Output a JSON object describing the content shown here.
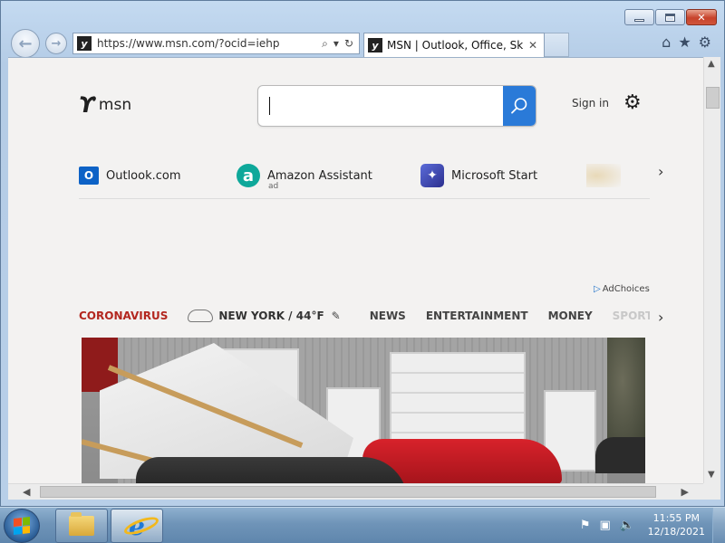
{
  "window": {
    "caption": {
      "minimize_icon": "minimize-icon",
      "maximize_icon": "maximize-icon",
      "close_glyph": "✕"
    }
  },
  "toolbar": {
    "back_glyph": "←",
    "forward_glyph": "→",
    "address": "https://www.msn.com/?ocid=iehp",
    "search_glyph": "⌕",
    "dropdown_glyph": "▾",
    "refresh_glyph": "↻",
    "home_glyph": "⌂",
    "favorites_glyph": "★",
    "tools_glyph": "⚙"
  },
  "tab": {
    "title": "MSN | Outlook, Office, Sky...",
    "close_glyph": "✕"
  },
  "msn": {
    "logo_text": "msn",
    "search_placeholder": "",
    "sign_in": "Sign in",
    "settings_glyph": "⚙",
    "quick_links": [
      {
        "label": "Outlook.com",
        "icon": "outlook-icon",
        "glyph": "O"
      },
      {
        "label": "Amazon Assistant",
        "icon": "amazon-icon",
        "glyph": "a",
        "sub": "ad"
      },
      {
        "label": "Microsoft Start",
        "icon": "microsoft-start-icon",
        "glyph": "✦"
      }
    ],
    "next_glyph": "›",
    "adchoices": "AdChoices",
    "adchoices_glyph": "▷",
    "nav": {
      "coronavirus": "CORONAVIRUS",
      "weather": "NEW YORK / 44°F",
      "edit_glyph": "✎",
      "items": [
        "NEWS",
        "ENTERTAINMENT",
        "MONEY",
        "SPORTS"
      ]
    }
  },
  "scroll": {
    "up_glyph": "▲",
    "down_glyph": "▼",
    "left_glyph": "◀",
    "right_glyph": "▶"
  },
  "taskbar": {
    "clock_time": "11:55 PM",
    "clock_date": "12/18/2021",
    "ie_glyph": "e",
    "tray": {
      "action_center_glyph": "⚑",
      "network_glyph": "▣",
      "volume_glyph": "🔈"
    }
  },
  "colors": {
    "coronavirus": "#b3271f",
    "search_button": "#2a7ad8",
    "outlook": "#0d62c6",
    "amazon": "#0ea89a"
  }
}
